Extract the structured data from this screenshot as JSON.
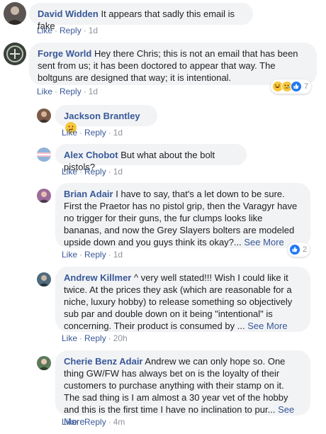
{
  "comments": [
    {
      "author": "David Widden",
      "text": "It appears that sadly this email is fake",
      "like": "Like",
      "reply": "Reply",
      "sep": "·",
      "time": "1d"
    },
    {
      "author": "Forge World",
      "text": "Hey there Chris; this is not an email that has been sent from us; it has been doctored to appear that way. The boltguns are designed that way; it is intentional.",
      "like": "Like",
      "reply": "Reply",
      "sep": "·",
      "time": "1d",
      "reaction_count": "7"
    },
    {
      "author": "Jackson Brantley",
      "text": "",
      "like": "Like",
      "reply": "Reply",
      "sep": "·",
      "time": "1d"
    },
    {
      "author": "Alex Chobot",
      "text": "But what about the bolt pistols?",
      "like": "Like",
      "reply": "Reply",
      "sep": "·",
      "time": "1d"
    },
    {
      "author": "Brian Adair",
      "text": "I have to say, that's a let down to be sure. First the Praetor has no pistol grip, then the Varagyr have no trigger for their guns, the fur clumps looks like bananas, and now the Grey Slayers bolters are modeled upside down and you guys think its okay?...",
      "see_more": "See More",
      "like": "Like",
      "reply": "Reply",
      "sep": "·",
      "time": "1d",
      "reaction_count": "2"
    },
    {
      "author": "Andrew Killmer",
      "text": "^ very well stated!!! Wish I could like it twice. At the prices they ask (which are reasonable for a niche, luxury hobby) to release something so objectively sub par and double down on it being \"intentional\" is concerning. Their product is consumed by ...",
      "see_more": "See More",
      "like": "Like",
      "reply": "Reply",
      "sep": "·",
      "time": "20h"
    },
    {
      "author": "Cherie Benz Adair",
      "text": "Andrew we can only hope so. One thing GW/FW has always bet on is the loyalty of their customers to purchase anything with their stamp on it. The sad thing is I am almost a 30 year vet of the hobby and this is the first time I have no inclination to pur...",
      "see_more": "See More",
      "like": "Like",
      "reply": "Reply",
      "sep": "·",
      "time": "4m"
    }
  ],
  "colors": {
    "author": "#385898",
    "bubble": "#f2f3f5",
    "meta": "#90949c",
    "like_reaction": "#2078f4",
    "emoji": "#f7c63c"
  },
  "icons": {
    "reactions_forge_world": [
      "haha-reaction-icon",
      "sad-reaction-icon",
      "like-reaction-icon"
    ],
    "reactions_brian_adair": [
      "like-reaction-icon"
    ],
    "jackson_emoji": "confused-face-icon"
  }
}
